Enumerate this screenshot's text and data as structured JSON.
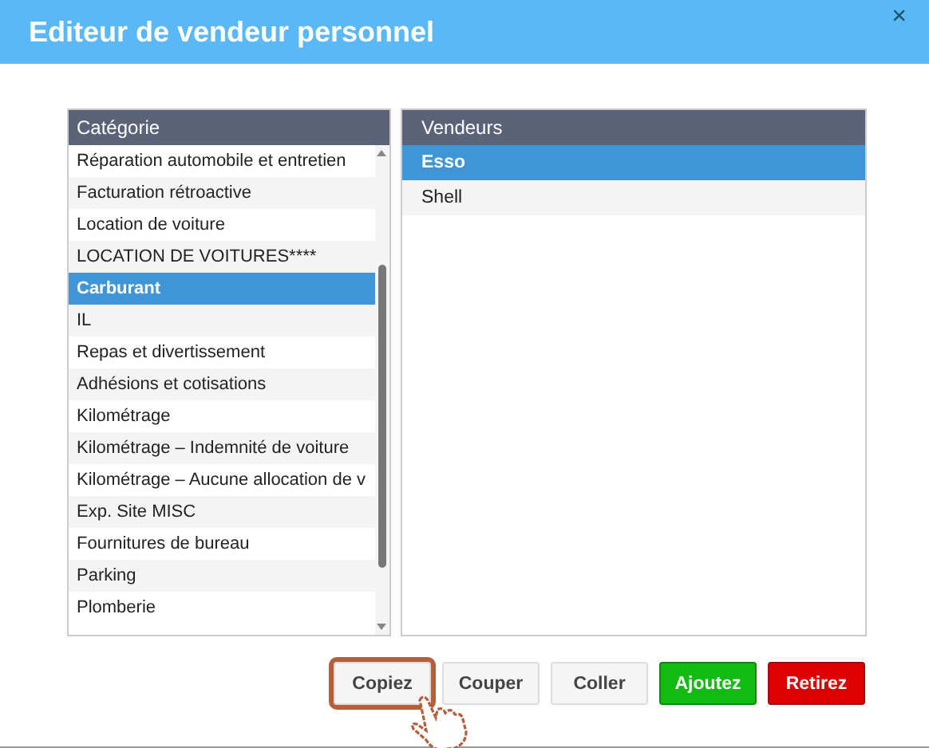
{
  "window": {
    "title": "Editeur de vendeur personnel",
    "close": "×"
  },
  "categories": {
    "header": "Catégorie",
    "items": [
      {
        "label": "Réparation automobile et entretien",
        "selected": false
      },
      {
        "label": "Facturation rétroactive",
        "selected": false
      },
      {
        "label": "Location de voiture",
        "selected": false
      },
      {
        "label": "LOCATION DE VOITURES****",
        "selected": false
      },
      {
        "label": "Carburant",
        "selected": true
      },
      {
        "label": "IL",
        "selected": false
      },
      {
        "label": "Repas et divertissement",
        "selected": false
      },
      {
        "label": "Adhésions et cotisations",
        "selected": false
      },
      {
        "label": "Kilométrage",
        "selected": false
      },
      {
        "label": "Kilométrage – Indemnité de voiture",
        "selected": false
      },
      {
        "label": "Kilométrage – Aucune allocation de v",
        "selected": false
      },
      {
        "label": "Exp. Site MISC",
        "selected": false
      },
      {
        "label": "Fournitures de bureau",
        "selected": false
      },
      {
        "label": "Parking",
        "selected": false
      },
      {
        "label": "Plomberie",
        "selected": false
      }
    ]
  },
  "vendors": {
    "header": "Vendeurs",
    "items": [
      {
        "label": "Esso",
        "selected": true
      },
      {
        "label": "Shell",
        "selected": false
      }
    ]
  },
  "buttons": [
    {
      "label": "Copiez",
      "kind": "default",
      "highlighted": true
    },
    {
      "label": "Couper",
      "kind": "default",
      "highlighted": false
    },
    {
      "label": "Coller",
      "kind": "default",
      "highlighted": false
    },
    {
      "label": "Ajoutez",
      "kind": "success",
      "highlighted": false
    },
    {
      "label": "Retirez",
      "kind": "danger",
      "highlighted": false
    }
  ]
}
